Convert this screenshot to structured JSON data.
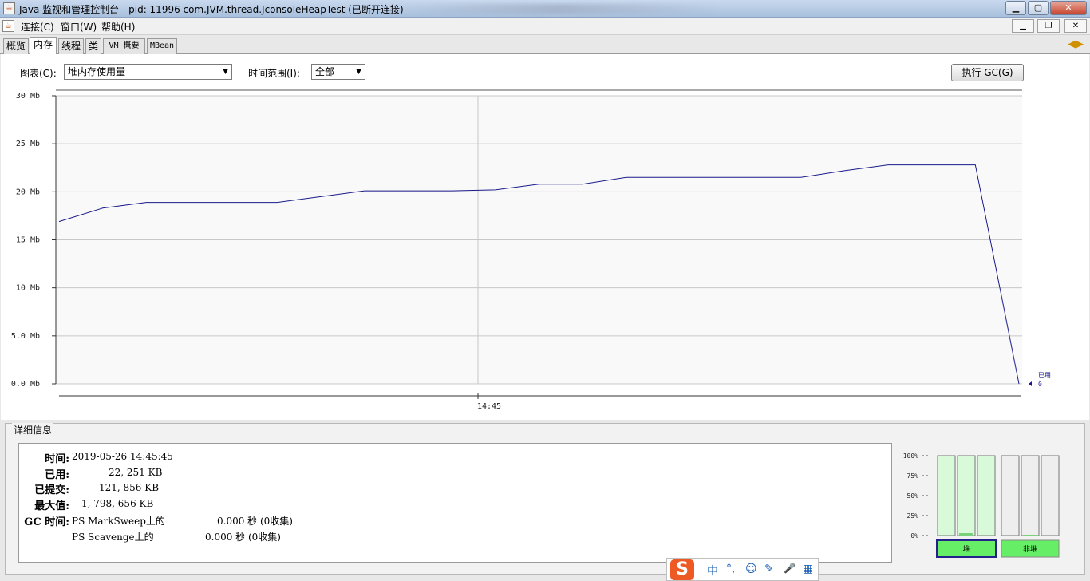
{
  "window": {
    "title": "Java 监视和管理控制台 - pid: 11996 com.JVM.thread.JconsoleHeapTest (已断开连接)"
  },
  "menu": {
    "items": [
      "连接(C)",
      "窗口(W)",
      "帮助(H)"
    ]
  },
  "tabs": [
    {
      "label": "概览",
      "active": false
    },
    {
      "label": "内存",
      "active": true
    },
    {
      "label": "线程",
      "active": false
    },
    {
      "label": "类",
      "active": false
    },
    {
      "label": "VM 概要",
      "active": false
    },
    {
      "label": "MBean",
      "active": false
    }
  ],
  "controls": {
    "chart_label": "图表(C):",
    "chart_value": "堆内存使用量",
    "range_label": "时间范围(I):",
    "range_value": "全部",
    "gc_button": "执行 GC(G)"
  },
  "chart_data": {
    "type": "line",
    "ylabels": [
      "30 Mb",
      "25 Mb",
      "20 Mb",
      "15 Mb",
      "10 Mb",
      "5.0 Mb",
      "0.0 Mb"
    ],
    "ylim": [
      0,
      30
    ],
    "xlabel_tick": "14:45",
    "series": [
      {
        "name": "已用",
        "color": "#1a1a8c",
        "values": [
          16.9,
          18.3,
          18.9,
          18.9,
          18.9,
          18.9,
          19.5,
          20.1,
          20.1,
          20.1,
          20.2,
          20.8,
          20.8,
          21.5,
          21.5,
          21.5,
          21.5,
          21.5,
          22.2,
          22.8,
          22.8,
          22.8,
          0.0
        ]
      }
    ],
    "end_label": "已用",
    "end_value": "0",
    "grid": true
  },
  "details": {
    "title": "详细信息",
    "rows": [
      {
        "label": "时间:",
        "value": "2019-05-26 14:45:45"
      },
      {
        "label": "已用:",
        "value": "22, 251 KB"
      },
      {
        "label": "已提交:",
        "value": "121, 856 KB"
      },
      {
        "label": "最大值:",
        "value": "1, 798, 656 KB"
      },
      {
        "label": "GC 时间:",
        "value": "PS MarkSweep上的"
      }
    ],
    "gc": [
      {
        "collector": "PS MarkSweep上的",
        "time": "0.000 秒 (0收集)"
      },
      {
        "collector": "PS Scavenge上的",
        "time": "0.000 秒 (0收集)"
      }
    ]
  },
  "bars": {
    "ticks": [
      "100%",
      "75%",
      "50%",
      "25%",
      "0%"
    ],
    "heap_label": "堆",
    "nonheap_label": "非堆",
    "heap_fill": [
      0.0,
      0.03,
      0.0
    ],
    "nonheap_fill": [
      0.0,
      0.01,
      0.0
    ]
  },
  "ime": {
    "logo": "S",
    "items": [
      "中",
      "°,",
      "☺",
      "✎",
      "🎤",
      "▦"
    ]
  }
}
